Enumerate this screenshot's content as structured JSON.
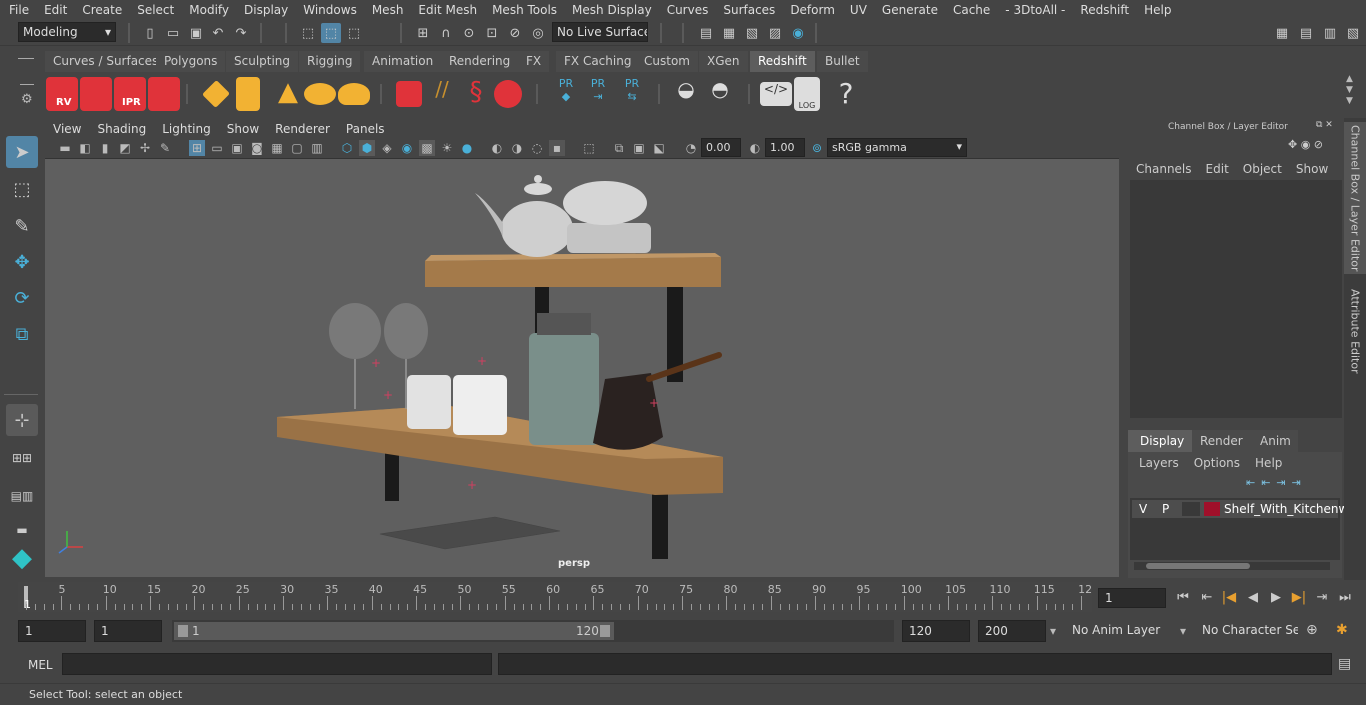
{
  "menubar": {
    "items": [
      "File",
      "Edit",
      "Create",
      "Select",
      "Modify",
      "Display",
      "Windows",
      "Mesh",
      "Edit Mesh",
      "Mesh Tools",
      "Mesh Display",
      "Curves",
      "Surfaces",
      "Deform",
      "UV",
      "Generate",
      "Cache",
      "- 3DtoAll -",
      "Redshift",
      "Help"
    ]
  },
  "status": {
    "mode": "Modeling",
    "live_surface": "No Live Surface"
  },
  "shelf_tabs": {
    "items": [
      "Curves / Surfaces",
      "Polygons",
      "Sculpting",
      "Rigging",
      "Animation",
      "Rendering",
      "FX",
      "FX Caching",
      "Custom",
      "XGen",
      "Redshift",
      "Bullet"
    ],
    "active": "Redshift"
  },
  "shelf": {
    "rv_label": "RV",
    "ipr_label": "IPR",
    "pr_label": "PR",
    "log_label": "LOG",
    "help_glyph": "?"
  },
  "viewport": {
    "menu": [
      "View",
      "Shading",
      "Lighting",
      "Show",
      "Renderer",
      "Panels"
    ],
    "exposure": "0.00",
    "gamma": "1.00",
    "color_space": "sRGB gamma",
    "camera_label": "persp"
  },
  "channel_box": {
    "title": "Channel Box / Layer Editor",
    "menu": [
      "Channels",
      "Edit",
      "Object",
      "Show"
    ]
  },
  "layer_editor": {
    "tabs": [
      "Display",
      "Render",
      "Anim"
    ],
    "active_tab": "Display",
    "menu": [
      "Layers",
      "Options",
      "Help"
    ],
    "layer": {
      "v": "V",
      "p": "P",
      "name": "Shelf_With_Kitchenwa",
      "color": "#a0102a"
    }
  },
  "side_tabs": [
    "Channel Box / Layer Editor",
    "Attribute Editor"
  ],
  "timeline": {
    "ticks": [
      "5",
      "10",
      "15",
      "20",
      "25",
      "30",
      "35",
      "40",
      "45",
      "50",
      "55",
      "60",
      "65",
      "70",
      "75",
      "80",
      "85",
      "90",
      "95",
      "100",
      "105",
      "110",
      "115",
      "12"
    ],
    "start_marker": "1",
    "current_frame": "1"
  },
  "range": {
    "start": "1",
    "playback_start": "1",
    "slider_start": "1",
    "slider_end": "120",
    "playback_end": "120",
    "end": "200",
    "anim_layer": "No Anim Layer",
    "character_set": "No Character Set"
  },
  "command": {
    "language": "MEL"
  },
  "help_line": {
    "text": "Select Tool: select an object"
  },
  "colors": {
    "accent": "#5285a6",
    "redshift_red": "#e0333a",
    "active_tab": "#5d5d5d"
  }
}
